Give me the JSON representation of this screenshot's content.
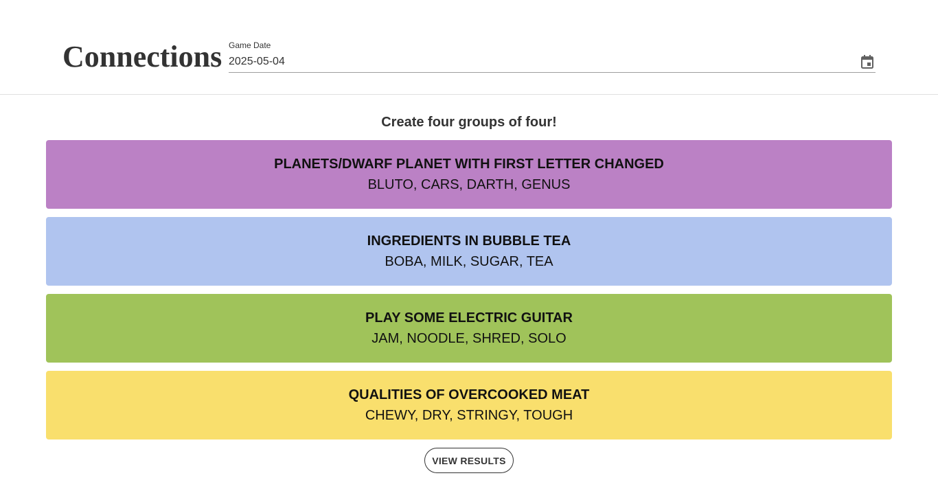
{
  "header": {
    "title": "Connections",
    "date_label": "Game Date",
    "date_value": "2025-05-04",
    "calendar_icon": "calendar-icon"
  },
  "main": {
    "subtitle": "Create four groups of four!",
    "groups": [
      {
        "title": "PLANETS/DWARF PLANET WITH FIRST LETTER CHANGED",
        "words": "BLUTO, CARS, DARTH, GENUS",
        "color": "#bb81c5"
      },
      {
        "title": "INGREDIENTS IN BUBBLE TEA",
        "words": "BOBA, MILK, SUGAR, TEA",
        "color": "#b0c4ef"
      },
      {
        "title": "PLAY SOME ELECTRIC GUITAR",
        "words": "JAM, NOODLE, SHRED, SOLO",
        "color": "#a0c35a"
      },
      {
        "title": "QUALITIES OF OVERCOOKED MEAT",
        "words": "CHEWY, DRY, STRINGY, TOUGH",
        "color": "#f9df6d"
      }
    ],
    "view_results_label": "VIEW RESULTS"
  }
}
